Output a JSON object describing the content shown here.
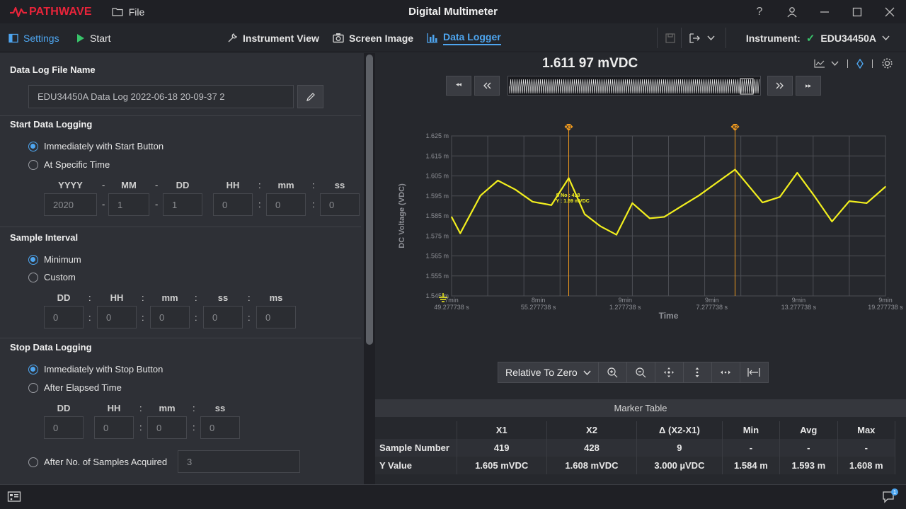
{
  "app": {
    "logo_text": "PATHWAVE",
    "file_menu": "File",
    "window_title": "Digital Multimeter"
  },
  "toolbar": {
    "settings": "Settings",
    "start": "Start",
    "instrument_view": "Instrument View",
    "screen_image": "Screen Image",
    "data_logger": "Data Logger",
    "instrument_label": "Instrument:",
    "instrument_name": "EDU34450A"
  },
  "left": {
    "file_name_title": "Data Log File Name",
    "file_name_value": "EDU34450A Data Log 2022-06-18 20-09-37 2",
    "start_title": "Start Data Logging",
    "start_opt1": "Immediately with Start Button",
    "start_opt2": "At Specific Time",
    "time_labels": {
      "yyyy": "YYYY",
      "mm": "MM",
      "dd": "DD",
      "hh": "HH",
      "min": "mm",
      "ss": "ss"
    },
    "time_values": {
      "yyyy": "2020",
      "mm": "1",
      "dd": "1",
      "hh": "0",
      "min": "0",
      "ss": "0"
    },
    "sep_dash": "-",
    "sep_colon": ":",
    "sample_title": "Sample Interval",
    "sample_opt1": "Minimum",
    "sample_opt2": "Custom",
    "interval_labels": {
      "dd": "DD",
      "hh": "HH",
      "mm": "mm",
      "ss": "ss",
      "ms": "ms"
    },
    "interval_values": {
      "dd": "0",
      "hh": "0",
      "mm": "0",
      "ss": "0",
      "ms": "0"
    },
    "stop_title": "Stop Data Logging",
    "stop_opt1": "Immediately with Stop Button",
    "stop_opt2": "After Elapsed Time",
    "elapsed_labels": {
      "dd": "DD",
      "hh": "HH",
      "mm": "mm",
      "ss": "ss"
    },
    "elapsed_values": {
      "dd": "0",
      "hh": "0",
      "mm": "0",
      "ss": "0"
    },
    "stop_opt3": "After No. of Samples Acquired",
    "samples_value": "3"
  },
  "right": {
    "reading": "1.611 97 mVDC",
    "relative_select": "Relative To Zero",
    "marker_table_title": "Marker Table"
  },
  "chart_data": {
    "type": "line",
    "title": "",
    "xlabel": "Time",
    "ylabel": "DC Voltage (VDC)",
    "ylim": [
      1.545,
      1.625
    ],
    "y_ticks": [
      "1.625 m",
      "1.615 m",
      "1.605 m",
      "1.595 m",
      "1.585 m",
      "1.575 m",
      "1.565 m",
      "1.555 m",
      "1.545 m"
    ],
    "y_tick_values": [
      1.625,
      1.615,
      1.605,
      1.595,
      1.585,
      1.575,
      1.565,
      1.555,
      1.545
    ],
    "x_ticks": [
      {
        "l1": "7min",
        "l2": "49.277738 s"
      },
      {
        "l1": "8min",
        "l2": "55.277738 s"
      },
      {
        "l1": "9min",
        "l2": "1.277738 s"
      },
      {
        "l1": "9min",
        "l2": "7.277738 s"
      },
      {
        "l1": "9min",
        "l2": "13.277738 s"
      },
      {
        "l1": "9min",
        "l2": "19.277738 s"
      }
    ],
    "x_tick_positions": [
      0,
      6,
      12,
      18,
      24,
      30
    ],
    "xlim": [
      0,
      30
    ],
    "grid": true,
    "series": [
      {
        "color": "#f2ef1e",
        "x": [
          0,
          0.6,
          2,
          3.2,
          4.4,
          5.6,
          6.9,
          8.1,
          9.2,
          10.3,
          11.4,
          12.5,
          13.7,
          14.7,
          15.9,
          17.1,
          19.6,
          21.5,
          22.7,
          23.9,
          25.1,
          26.3,
          27.5,
          28.7,
          30
        ],
        "y": [
          1.5845,
          1.5763,
          1.5952,
          1.6027,
          1.5982,
          1.5921,
          1.5904,
          1.6039,
          1.5859,
          1.5798,
          1.5756,
          1.5914,
          1.5838,
          1.5845,
          1.5899,
          1.5952,
          1.6082,
          1.5917,
          1.5945,
          1.6066,
          1.5948,
          1.5822,
          1.5924,
          1.5914,
          1.5996
        ]
      }
    ],
    "markers": [
      {
        "label": "X1",
        "x": 8.1,
        "color": "#f29b1e"
      },
      {
        "label": "X2",
        "x": 19.6,
        "color": "#f29b1e"
      }
    ],
    "cursor_readout": {
      "line1": "S No : 418",
      "line2": "Y : 1.59 mVDC",
      "x": 8.1,
      "y": 1.59
    }
  },
  "marker_table": {
    "columns": [
      "",
      "X1",
      "X2",
      "Δ (X2-X1)",
      "Min",
      "Avg",
      "Max"
    ],
    "rows": [
      [
        "Sample Number",
        "419",
        "428",
        "9",
        "-",
        "-",
        "-"
      ],
      [
        "Y Value",
        "1.605 mVDC",
        "1.608 mVDC",
        "3.000 µVDC",
        "1.584 m",
        "1.593 m",
        "1.608 m"
      ]
    ]
  },
  "colors": {
    "accent": "#4ea6f0",
    "trace": "#f2ef1e",
    "marker": "#f29b1e",
    "check": "#38c46a",
    "logo": "#e8243a"
  }
}
